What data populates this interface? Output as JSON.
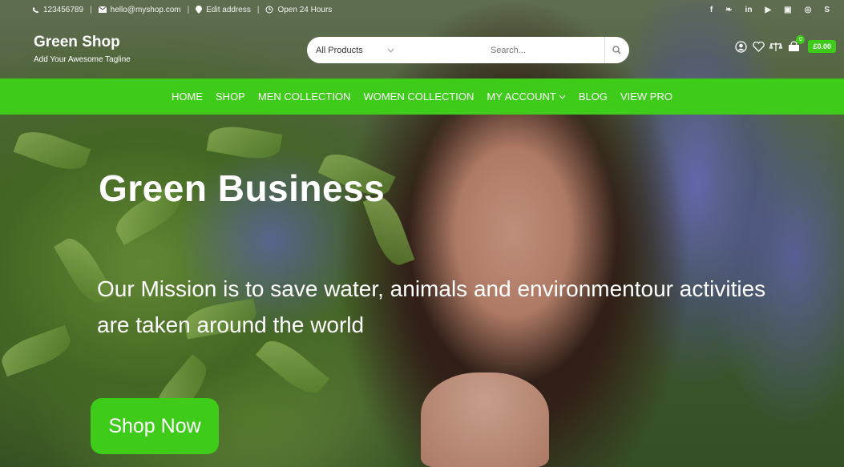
{
  "topbar": {
    "phone": "123456789",
    "email": "hello@myshop.com",
    "address": "Edit address",
    "hours": "Open 24 Hours",
    "socials": [
      "facebook-icon",
      "twitter-icon",
      "linkedin-icon",
      "youtube-icon",
      "instagram-icon",
      "dribbble-icon",
      "skype-icon"
    ]
  },
  "brand": {
    "name": "Green Shop",
    "tagline": "Add Your Awesome Tagline"
  },
  "search": {
    "category": "All Products",
    "placeholder": "Search..."
  },
  "cart": {
    "count": "0",
    "total": "£0.00"
  },
  "nav": {
    "items": [
      "HOME",
      "SHOP",
      "MEN COLLECTION",
      "WOMEN COLLECTION",
      "MY ACCOUNT",
      "BLOG",
      "VIEW PRO"
    ]
  },
  "hero": {
    "title": "Green Business",
    "text": "Our Mission is to save water, animals and environmentour activities are taken around the world",
    "button": "Shop Now"
  },
  "colors": {
    "accent": "#3ecb1a"
  }
}
